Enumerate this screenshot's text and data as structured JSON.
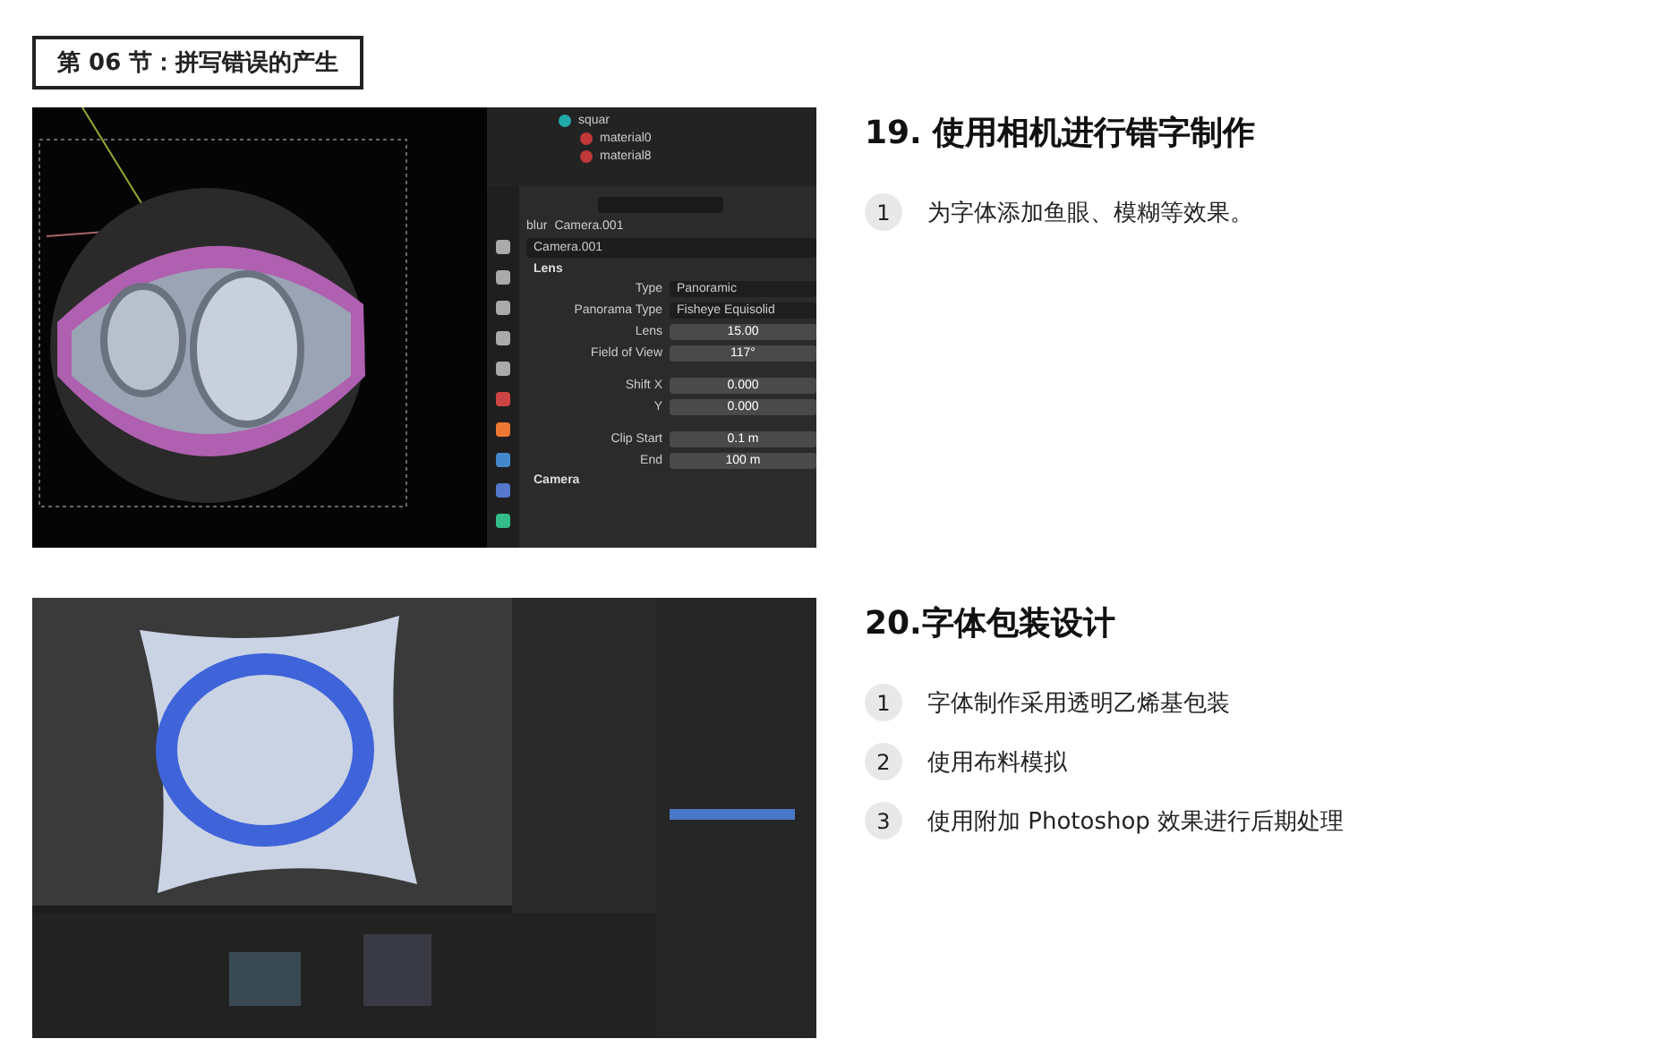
{
  "section_title": "第 06 节：拼写错误的产生",
  "lessons": [
    {
      "title": "19. 使用相机进行错字制作",
      "image": {
        "kind": "camera-panel",
        "outliner": [
          "squar",
          "material0",
          "material8"
        ],
        "breadcrumb": [
          "blur",
          "Camera.001"
        ],
        "camera_name": "Camera.001",
        "panel": "Lens",
        "properties": [
          {
            "label": "Type",
            "value": "Panoramic",
            "kind": "menu"
          },
          {
            "label": "Panorama Type",
            "value": "Fisheye Equisolid",
            "kind": "menu"
          },
          {
            "label": "Lens",
            "value": "15.00",
            "kind": "number"
          },
          {
            "label": "Field of View",
            "value": "117°",
            "kind": "number"
          },
          {
            "label": "Shift X",
            "value": "0.000",
            "kind": "number"
          },
          {
            "label": "Y",
            "value": "0.000",
            "kind": "number"
          },
          {
            "label": "Clip Start",
            "value": "0.1 m",
            "kind": "number"
          },
          {
            "label": "End",
            "value": "100 m",
            "kind": "number"
          }
        ],
        "next_panel": "Camera"
      },
      "steps": [
        {
          "number": "1",
          "text": "为字体添加鱼眼、模糊等效果。"
        }
      ]
    },
    {
      "title": "20.字体包装设计",
      "image": {
        "kind": "cloth-scene"
      },
      "steps": [
        {
          "number": "1",
          "text": "字体制作采用透明乙烯基包装"
        },
        {
          "number": "2",
          "text": "使用布料模拟"
        },
        {
          "number": "3",
          "text": "使用附加 Photoshop 效果进行后期处理"
        }
      ]
    }
  ]
}
